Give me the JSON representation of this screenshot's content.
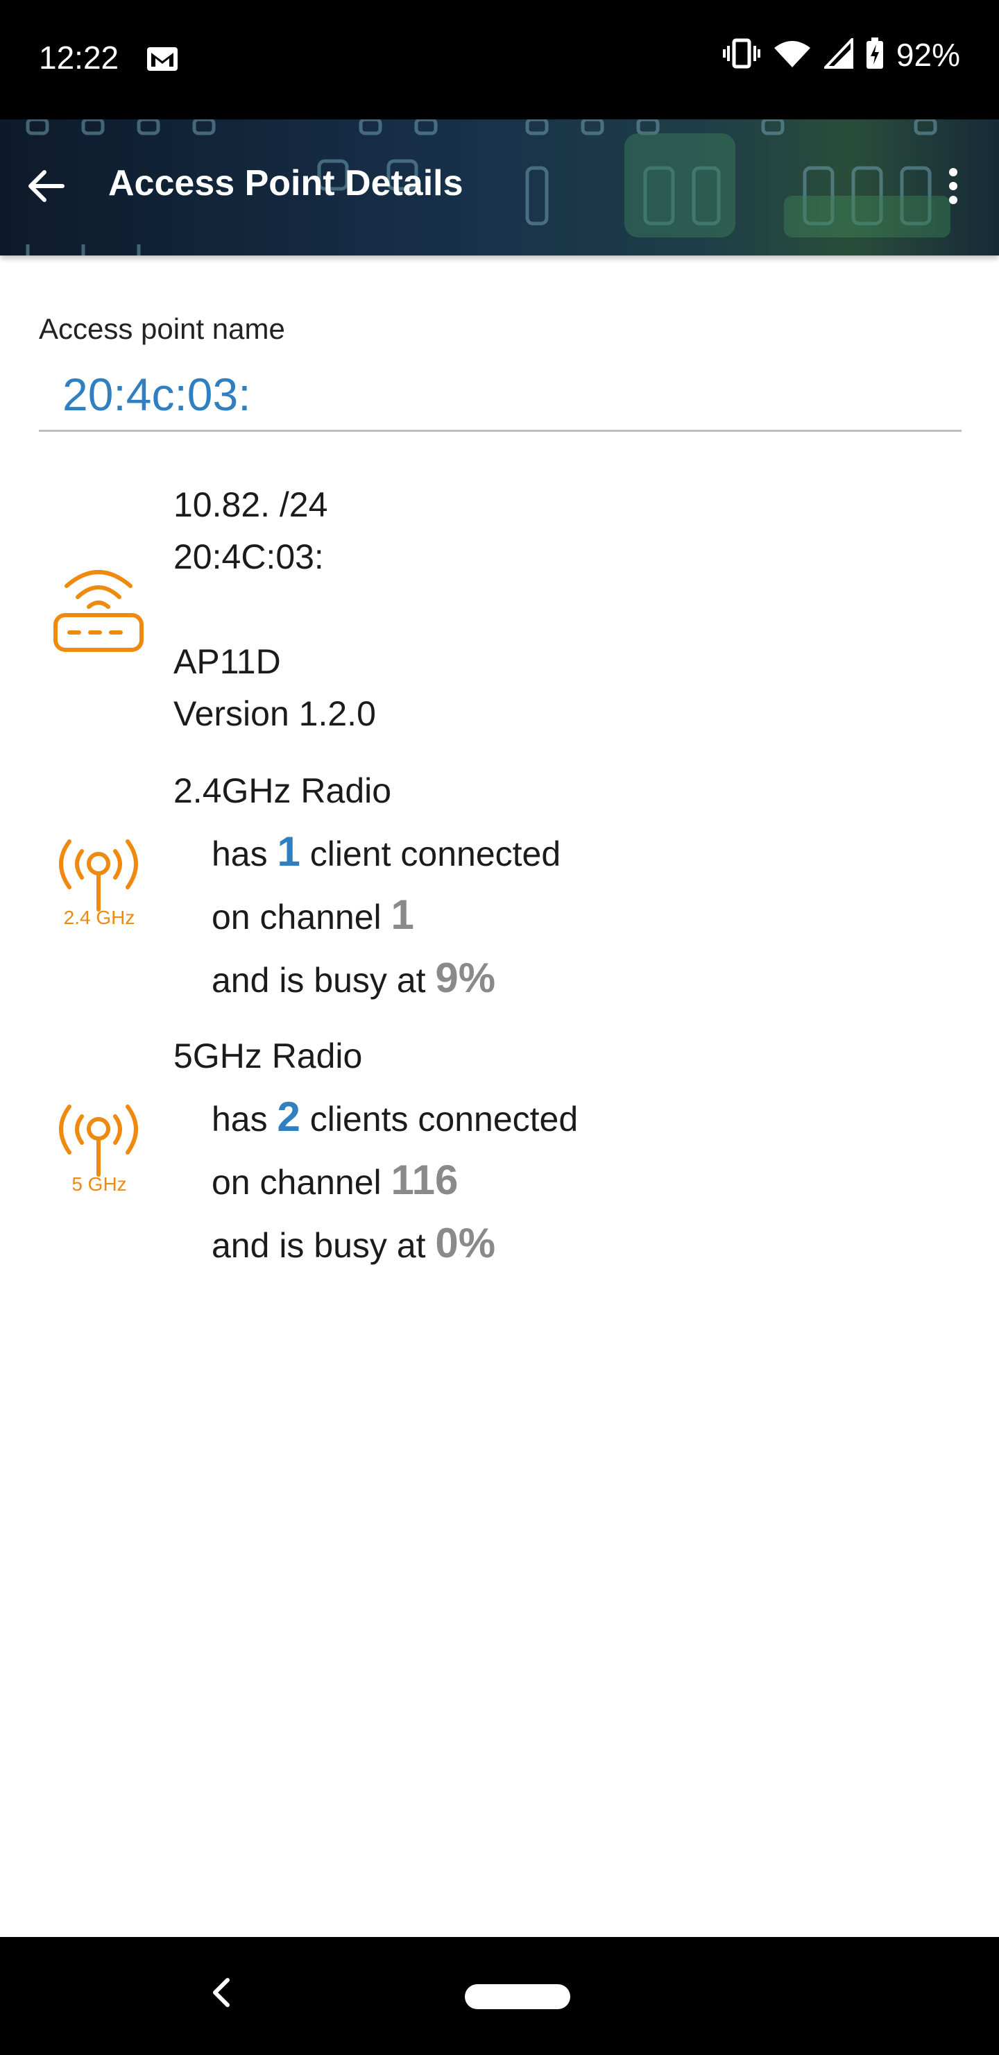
{
  "status_bar": {
    "time": "12:22",
    "battery": "92%",
    "icons": [
      "mail-icon",
      "vibrate-icon",
      "wifi-icon",
      "cell-signal-icon",
      "battery-charging-icon"
    ]
  },
  "toolbar": {
    "title": "Access Point Details",
    "back_icon": "arrow-left-icon",
    "menu_icon": "more-vert-icon"
  },
  "ap_name": {
    "label": "Access point name",
    "value": "20:4c:03:"
  },
  "device": {
    "icon": "router-icon",
    "ip": "10.82.        /24",
    "mac": "20:4C:03:",
    "model": "AP11D",
    "version": "Version 1.2.0"
  },
  "radios": [
    {
      "title": "2.4GHz Radio",
      "icon_label": "2.4 GHz",
      "line1_pre": "has ",
      "clients": "1",
      "line1_post": " client connected",
      "line2_pre": "on channel ",
      "channel": "1",
      "line3_pre": "and is busy at ",
      "busy": "9%"
    },
    {
      "title": "5GHz Radio",
      "icon_label": "5 GHz",
      "line1_pre": "has ",
      "clients": "2",
      "line1_post": " clients connected",
      "line2_pre": "on channel ",
      "channel": "116",
      "line3_pre": "and is busy at ",
      "busy": "0%"
    }
  ],
  "colors": {
    "accent": "#2f7fc1",
    "icon_orange": "#ef8a11",
    "stat_gray": "#8a8a8a"
  }
}
